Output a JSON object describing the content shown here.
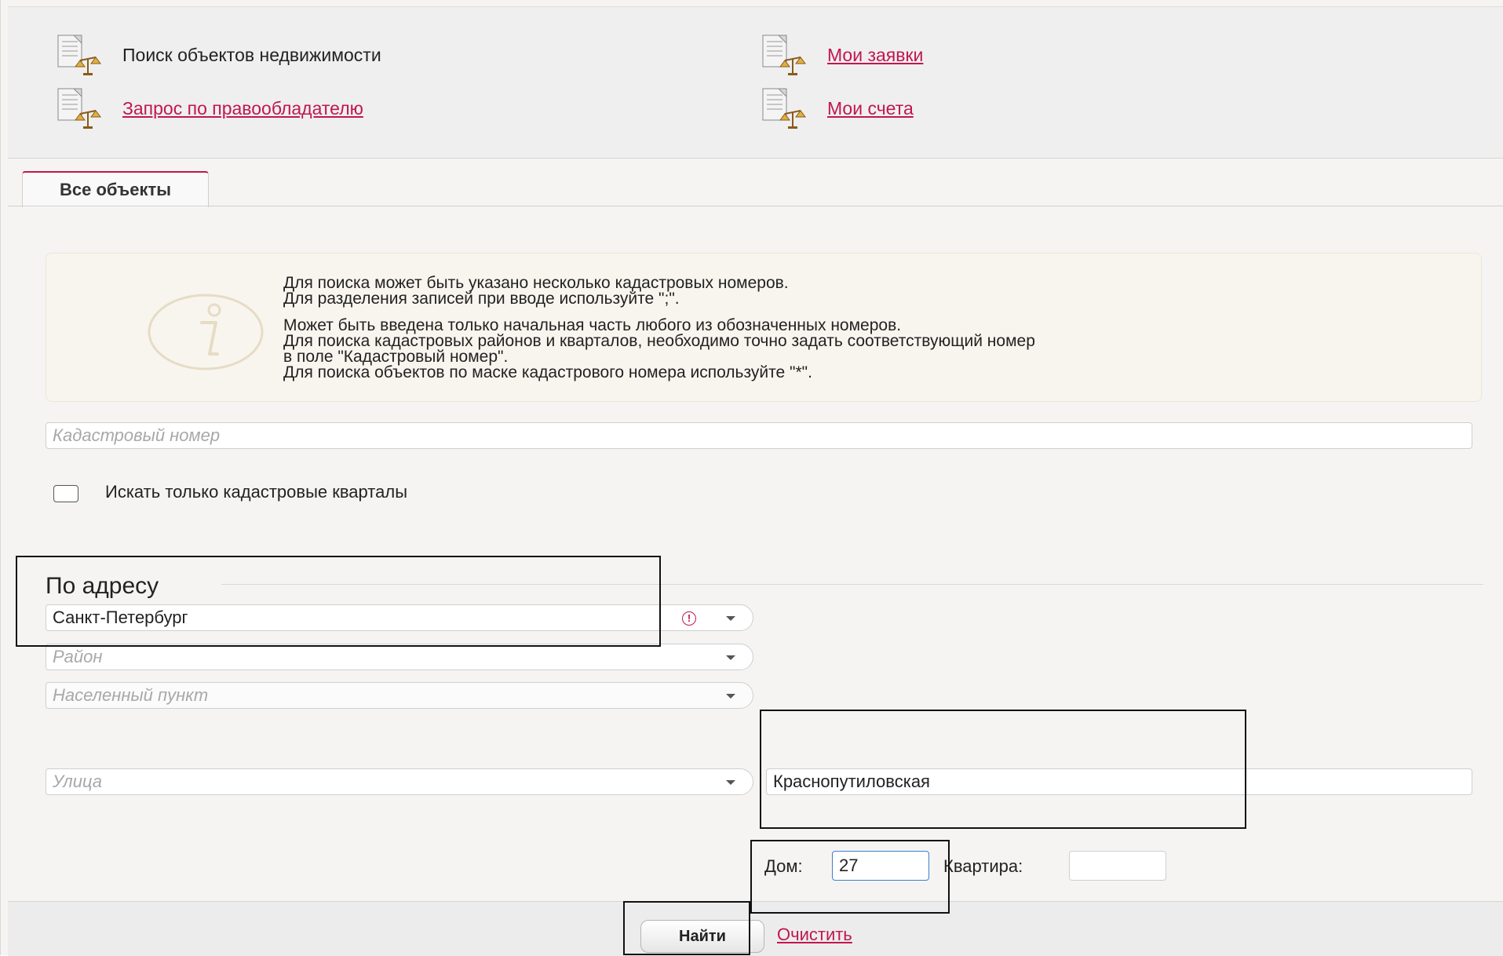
{
  "top_links": [
    {
      "label": "Поиск объектов недвижимости",
      "active": true
    },
    {
      "label": "Мои заявки",
      "active": false
    },
    {
      "label": "Запрос по правообладателю",
      "active": false
    },
    {
      "label": "Мои счета",
      "active": false
    }
  ],
  "tab": {
    "label": "Все объекты"
  },
  "info": {
    "lines": [
      "Для поиска может быть указано несколько кадастровых номеров.",
      "Для разделения записей при вводе используйте \";\".",
      "Может быть введена только начальная часть любого из обозначенных номеров.",
      "Для поиска кадастровых районов и кварталов, необходимо точно задать соответствующий номер",
      "в поле \"Кадастровый номер\".",
      "Для поиска объектов по маске кадастрового номера используйте \"*\"."
    ]
  },
  "cadastral": {
    "placeholder": "Кадастровый номер",
    "value": ""
  },
  "checkbox": {
    "label": "Искать только кадастровые кварталы",
    "checked": false
  },
  "address": {
    "title": "По адресу",
    "region": {
      "value": "Санкт-Петербург"
    },
    "district": {
      "placeholder": "Район"
    },
    "locality": {
      "placeholder": "Населенный пункт"
    },
    "street": {
      "placeholder": "Улица"
    },
    "street_name": {
      "value": "Краснопутиловская"
    },
    "house": {
      "label": "Дом:",
      "value": "27"
    },
    "apartment": {
      "label": "Квартира:",
      "value": ""
    }
  },
  "actions": {
    "find": "Найти",
    "clear": "Очистить"
  },
  "colors": {
    "link": "#c0174f",
    "tab_accent": "#c0174f",
    "panel": "#efefef"
  }
}
